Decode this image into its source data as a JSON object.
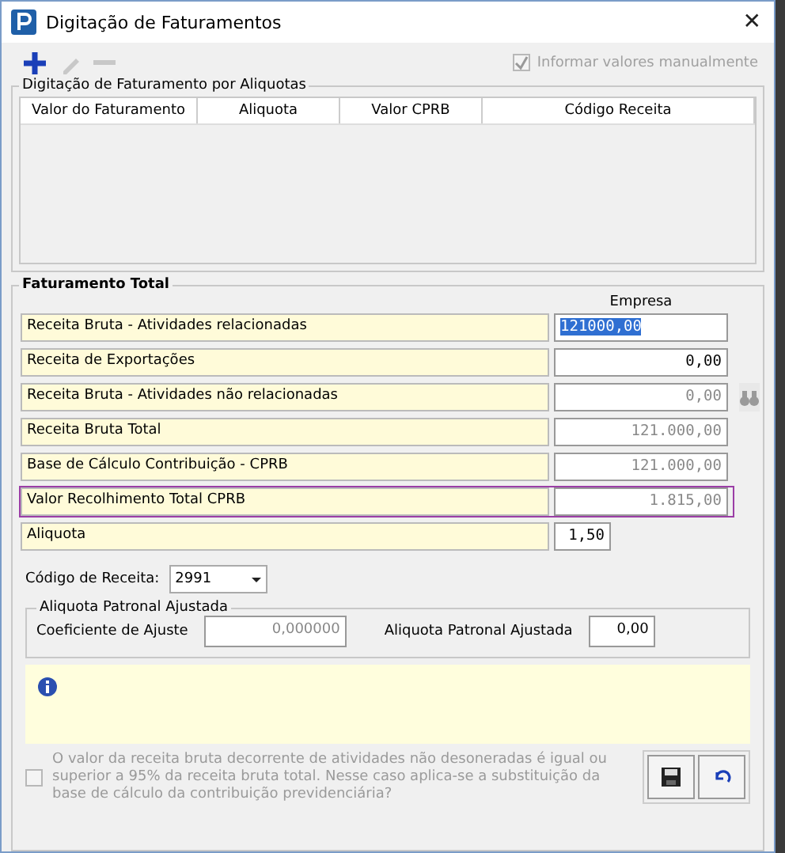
{
  "window": {
    "title": "Digitação de Faturamentos",
    "close": "✕"
  },
  "toolbar": [
    {
      "kind": "add",
      "disabled": false
    },
    {
      "kind": "edit",
      "disabled": true
    },
    {
      "kind": "remove",
      "disabled": true
    }
  ],
  "manual_checkbox": {
    "label": "Informar valores manualmente",
    "checked": true,
    "disabled": true
  },
  "aliquotas_group": {
    "title": "Digitação de Faturamento por Aliquotas",
    "columns": [
      "Valor do Faturamento",
      "Aliquota",
      "Valor CPRB",
      "Código Receita"
    ]
  },
  "total_group": {
    "title": "Faturamento Total",
    "column_header": "Empresa",
    "rows": [
      {
        "label": "Receita Bruta - Atividades relacionadas",
        "value": "121000,00",
        "disabled": false,
        "selected": true,
        "highlighted": false,
        "search": false,
        "narrow": false
      },
      {
        "label": "Receita de Exportações",
        "value": "0,00",
        "disabled": false,
        "selected": false,
        "highlighted": false,
        "search": false,
        "narrow": false
      },
      {
        "label": "Receita Bruta - Atividades não relacionadas",
        "value": "0,00",
        "disabled": true,
        "selected": false,
        "highlighted": false,
        "search": true,
        "narrow": false
      },
      {
        "label": "Receita Bruta Total",
        "value": "121.000,00",
        "disabled": true,
        "selected": false,
        "highlighted": false,
        "search": false,
        "narrow": false
      },
      {
        "label": "Base de Cálculo Contribuição - CPRB",
        "value": "121.000,00",
        "disabled": true,
        "selected": false,
        "highlighted": false,
        "search": false,
        "narrow": false
      },
      {
        "label": "Valor Recolhimento Total CPRB",
        "value": "1.815,00",
        "disabled": true,
        "selected": false,
        "highlighted": true,
        "search": false,
        "narrow": false
      },
      {
        "label": "Aliquota",
        "value": "1,50",
        "disabled": false,
        "selected": false,
        "highlighted": false,
        "search": false,
        "narrow": true
      }
    ],
    "codigo": {
      "label": "Código de Receita:",
      "value": "2991"
    },
    "patronal": {
      "title": "Aliquota Patronal Ajustada",
      "coef_label": "Coeficiente de Ajuste",
      "coef_value": "0,000000",
      "aliq_label": "Aliquota Patronal Ajustada",
      "aliq_value": "0,00"
    },
    "question": {
      "text": "O valor da receita bruta decorrente de atividades não desoneradas é igual ou superior a 95% da receita bruta total. Nesse caso aplica-se a substituição da base de cálculo da contribuição previdenciária?",
      "checked": false,
      "disabled": true
    }
  }
}
